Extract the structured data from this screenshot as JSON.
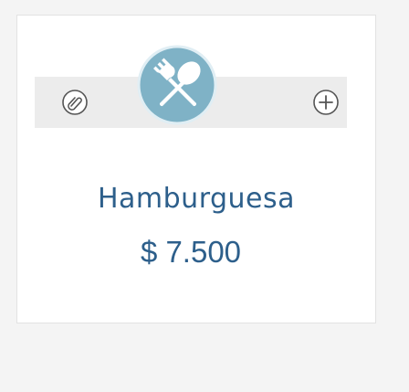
{
  "product": {
    "name": "Hamburguesa",
    "price": "$ 7.500"
  },
  "icons": {
    "edit": "paperclip-icon",
    "main": "fork-knife-icon",
    "add": "plus-icon"
  },
  "colors": {
    "accent": "#7fb2c6",
    "text": "#2d5f8b",
    "strip": "#ececec"
  }
}
